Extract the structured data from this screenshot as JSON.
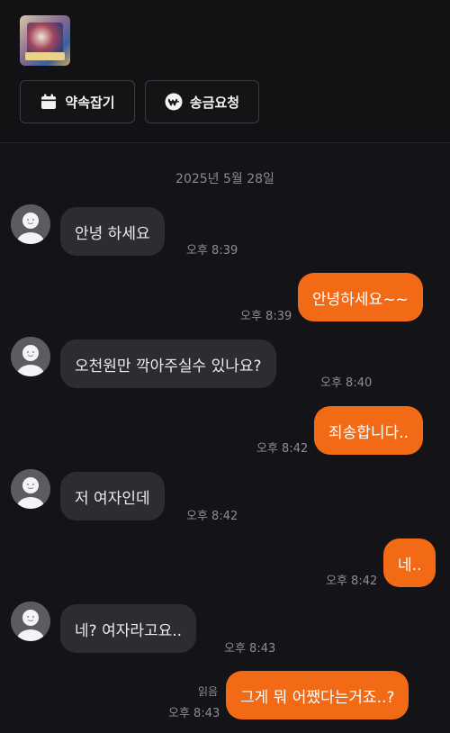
{
  "header": {
    "product_thumbnail": "product-image",
    "buttons": [
      {
        "label": "약속잡기",
        "icon": "calendar-icon"
      },
      {
        "label": "송금요청",
        "icon": "won-circle-icon"
      }
    ]
  },
  "chat": {
    "date": "2025년 5월 28일",
    "messages": [
      {
        "side": "in",
        "text": "안녕 하세요",
        "time": "오후 8:39"
      },
      {
        "side": "out",
        "text": "안녕하세요~~",
        "time": "오후 8:39"
      },
      {
        "side": "in",
        "text": "오천원만 깍아주실수 있나요?",
        "time": "오후 8:40"
      },
      {
        "side": "out",
        "text": "죄송합니다..",
        "time": "오후 8:42"
      },
      {
        "side": "in",
        "text": "저 여자인데",
        "time": "오후 8:42"
      },
      {
        "side": "out",
        "text": "네..",
        "time": "오후 8:42"
      },
      {
        "side": "in",
        "text": "네? 여자라고요..",
        "time": "오후 8:43"
      },
      {
        "side": "out",
        "text": "그게 뭐 어쨌다는거죠..?",
        "time": "오후 8:43",
        "read_label": "읽음"
      }
    ]
  },
  "colors": {
    "background": "#141418",
    "incoming_bubble": "#2c2c31",
    "outgoing_bubble": "#f36a16",
    "meta_text": "#8c8c94"
  }
}
